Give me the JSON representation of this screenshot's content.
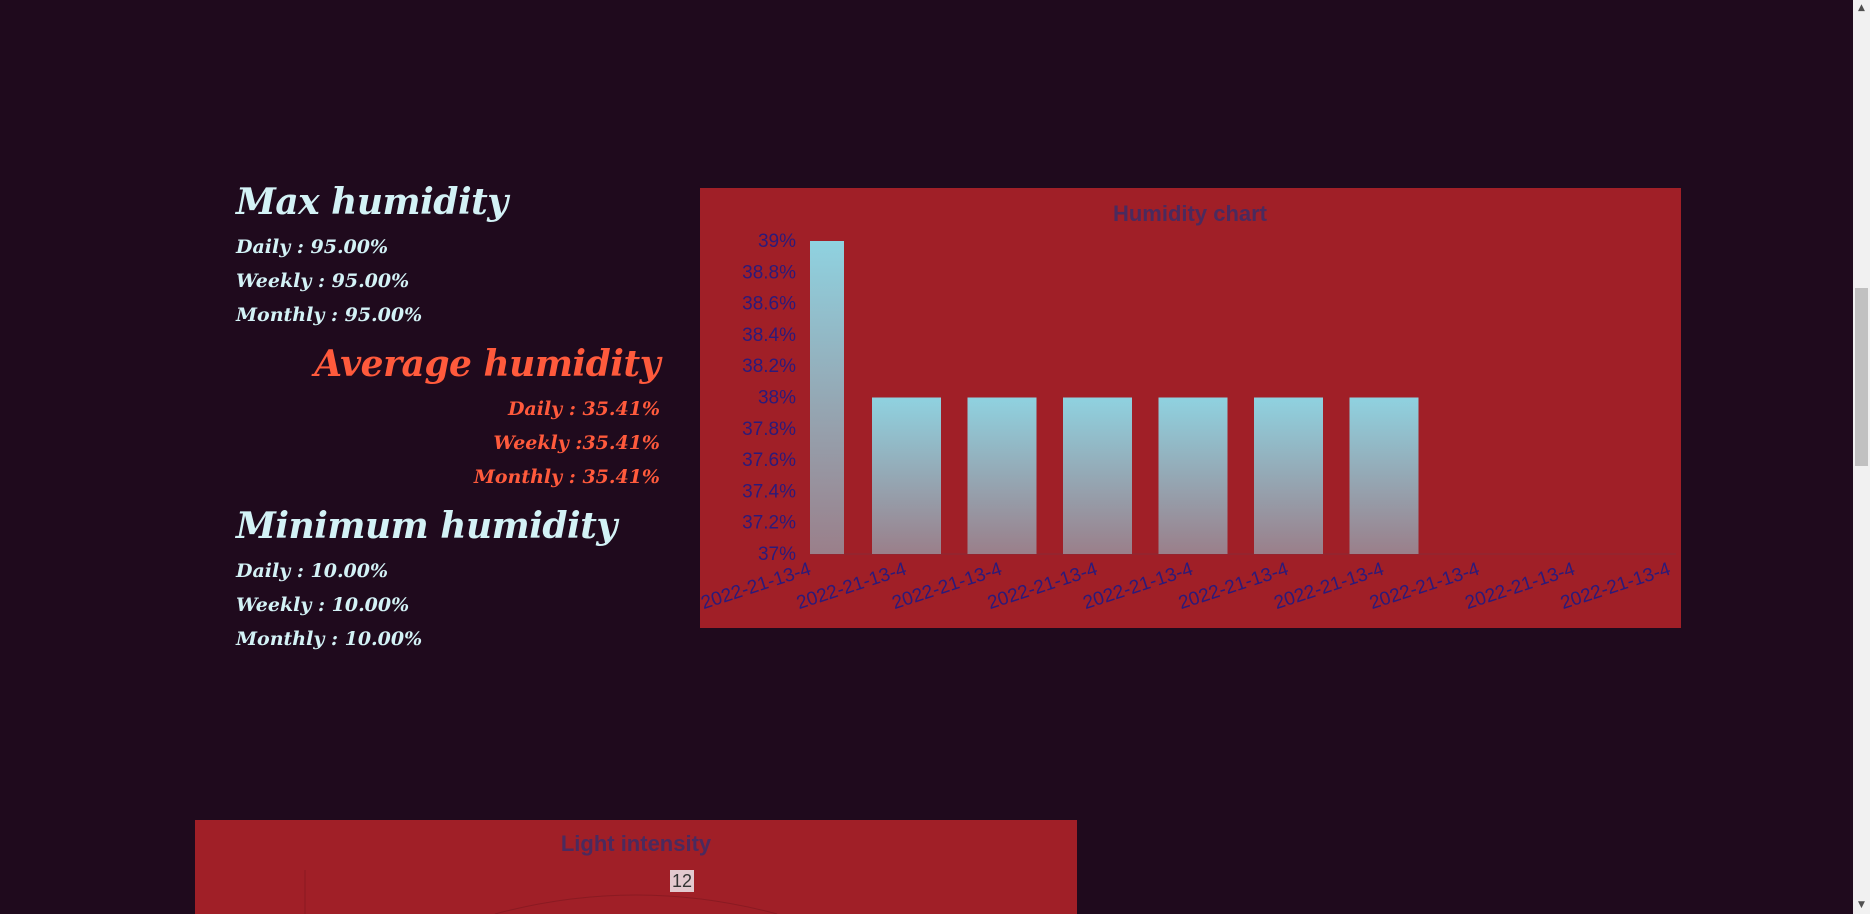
{
  "max": {
    "title": "Max humidity",
    "daily": "Daily : 95.00%",
    "weekly": "Weekly : 95.00%",
    "monthly": "Monthly : 95.00%"
  },
  "avg": {
    "title": "Average humidity",
    "daily": "Daily : 35.41%",
    "weekly": "Weekly :35.41%",
    "monthly": "Monthly : 35.41%"
  },
  "min": {
    "title": "Minimum humidity",
    "daily": "Daily : 10.00%",
    "weekly": "Weekly : 10.00%",
    "monthly": "Monthly : 10.00%"
  },
  "light": {
    "title": "Light intensity",
    "tick": "12"
  },
  "colors": {
    "background": "#1f0a1d",
    "panel": "#a01f27",
    "cool_text": "#d3f2f6",
    "warm_text": "#ff5a3c",
    "bar_top": "#8fd2e0",
    "bar_bottom": "#9a7f8a",
    "axis_text": "#2b1a7a",
    "chart_title": "#4a2a5e"
  },
  "chart_data": {
    "type": "bar",
    "title": "Humidity chart",
    "categories": [
      "2022-21-13-4",
      "2022-21-13-4",
      "2022-21-13-4",
      "2022-21-13-4",
      "2022-21-13-4",
      "2022-21-13-4",
      "2022-21-13-4",
      "2022-21-13-4",
      "2022-21-13-4",
      "2022-21-13-4"
    ],
    "values": [
      39,
      38,
      38,
      38,
      38,
      38,
      38,
      null,
      null,
      null
    ],
    "yticks": [
      "39%",
      "38.8%",
      "38.6%",
      "38.4%",
      "38.2%",
      "38%",
      "37.8%",
      "37.6%",
      "37.4%",
      "37.2%",
      "37%"
    ],
    "ylim": [
      37,
      39
    ],
    "grid": false,
    "legend": "none"
  }
}
